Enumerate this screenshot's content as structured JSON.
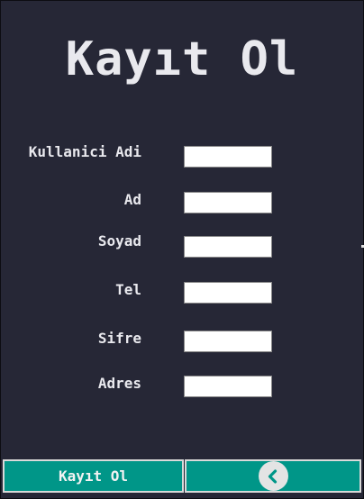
{
  "title": "Kayıt Ol",
  "fields": [
    {
      "label": "Kullanici Adi",
      "value": ""
    },
    {
      "label": "Ad",
      "value": ""
    },
    {
      "label": "Soyad",
      "value": ""
    },
    {
      "label": "Tel",
      "value": ""
    },
    {
      "label": "Sifre",
      "value": ""
    },
    {
      "label": "Adres",
      "value": ""
    }
  ],
  "buttons": {
    "register_label": "Kayıt Ol",
    "back_icon": "chevron-left-icon"
  },
  "colors": {
    "background": "#262736",
    "accent": "#009688",
    "text": "#e9e9ee"
  }
}
